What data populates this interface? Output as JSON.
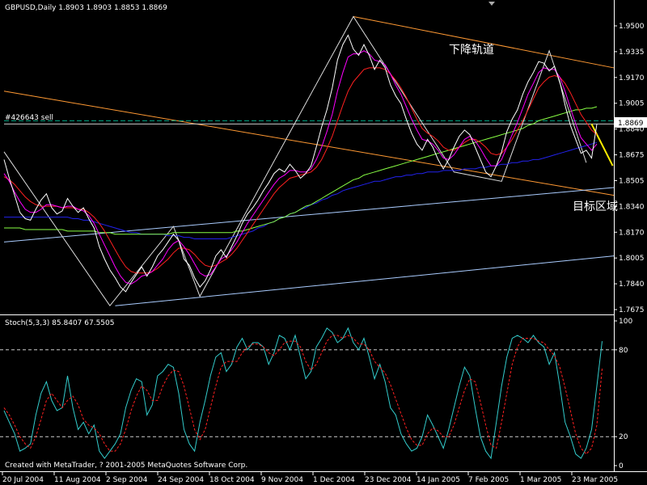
{
  "chart_data": [
    {
      "type": "line",
      "header": "GBPUSD,Daily  1.8903 1.8903 1.8853 1.8869",
      "symbol": "GBPUSD",
      "timeframe": "Daily",
      "ohlc": {
        "open": 1.8903,
        "high": 1.8903,
        "low": 1.8853,
        "close": 1.8869
      },
      "order_label": "#426643 sell",
      "price_tag": "1.8869",
      "annotations": {
        "down_channel": "下降轨道",
        "target_zone": "目标区域"
      },
      "ylim": [
        1.76,
        1.964
      ],
      "y_ticks": [
        "1.9500",
        "1.9335",
        "1.9170",
        "1.9005",
        "1.8840",
        "1.8675",
        "1.8505",
        "1.8340",
        "1.8170",
        "1.8005",
        "1.7840",
        "1.7675"
      ],
      "x_ticks": [
        "20 Jul 2004",
        "11 Aug 2004",
        "2 Sep 2004",
        "24 Sep 2004",
        "18 Oct 2004",
        "9 Nov 2004",
        "1 Dec 2004",
        "23 Dec 2004",
        "14 Jan 2005",
        "7 Feb 2005",
        "1 Mar 2005",
        "23 Mar 2005"
      ],
      "series": [
        {
          "key": "close",
          "color": "#ffffff",
          "values": [
            1.864,
            1.852,
            1.841,
            1.83,
            1.826,
            1.825,
            1.832,
            1.838,
            1.842,
            1.833,
            1.829,
            1.831,
            1.839,
            1.834,
            1.83,
            1.833,
            1.826,
            1.82,
            1.808,
            1.8,
            1.793,
            1.788,
            1.782,
            1.779,
            1.785,
            1.79,
            1.795,
            1.789,
            1.795,
            1.802,
            1.806,
            1.811,
            1.816,
            1.812,
            1.8,
            1.796,
            1.788,
            1.782,
            1.786,
            1.793,
            1.802,
            1.806,
            1.801,
            1.808,
            1.815,
            1.823,
            1.829,
            1.833,
            1.838,
            1.844,
            1.849,
            1.855,
            1.858,
            1.856,
            1.861,
            1.857,
            1.852,
            1.855,
            1.86,
            1.872,
            1.885,
            1.896,
            1.91,
            1.928,
            1.938,
            1.944,
            1.935,
            1.931,
            1.938,
            1.931,
            1.922,
            1.928,
            1.923,
            1.912,
            1.905,
            1.9,
            1.89,
            1.881,
            1.874,
            1.87,
            1.877,
            1.872,
            1.864,
            1.858,
            1.864,
            1.872,
            1.879,
            1.883,
            1.88,
            1.872,
            1.864,
            1.856,
            1.853,
            1.86,
            1.869,
            1.882,
            1.89,
            1.896,
            1.906,
            1.914,
            1.92,
            1.927,
            1.926,
            1.921,
            1.924,
            1.914,
            1.899,
            1.886,
            1.877,
            1.868,
            1.87,
            1.865,
            1.8869
          ]
        },
        {
          "key": "ma_fast",
          "color": "#ff00ff",
          "values": [
            1.855,
            1.85,
            1.843,
            1.837,
            1.832,
            1.83,
            1.83,
            1.832,
            1.835,
            1.835,
            1.834,
            1.833,
            1.834,
            1.834,
            1.832,
            1.831,
            1.828,
            1.823,
            1.816,
            1.809,
            1.802,
            1.795,
            1.789,
            1.785,
            1.784,
            1.786,
            1.789,
            1.79,
            1.792,
            1.796,
            1.8,
            1.806,
            1.81,
            1.812,
            1.808,
            1.803,
            1.797,
            1.791,
            1.789,
            1.79,
            1.795,
            1.8,
            1.802,
            1.806,
            1.811,
            1.817,
            1.823,
            1.828,
            1.833,
            1.838,
            1.843,
            1.848,
            1.852,
            1.854,
            1.857,
            1.857,
            1.856,
            1.856,
            1.858,
            1.864,
            1.872,
            1.882,
            1.893,
            1.908,
            1.92,
            1.93,
            1.932,
            1.932,
            1.934,
            1.932,
            1.928,
            1.927,
            1.925,
            1.919,
            1.912,
            1.906,
            1.898,
            1.89,
            1.883,
            1.877,
            1.876,
            1.874,
            1.87,
            1.865,
            1.864,
            1.867,
            1.872,
            1.877,
            1.879,
            1.876,
            1.871,
            1.865,
            1.86,
            1.86,
            1.864,
            1.872,
            1.88,
            1.888,
            1.897,
            1.906,
            1.913,
            1.92,
            1.923,
            1.922,
            1.922,
            1.917,
            1.908,
            1.897,
            1.887,
            1.878,
            1.874,
            1.87,
            1.874
          ]
        },
        {
          "key": "ma_mid",
          "color": "#ff2020",
          "values": [
            1.853,
            1.851,
            1.848,
            1.844,
            1.84,
            1.837,
            1.835,
            1.834,
            1.834,
            1.834,
            1.834,
            1.833,
            1.833,
            1.833,
            1.832,
            1.832,
            1.83,
            1.827,
            1.823,
            1.818,
            1.812,
            1.806,
            1.8,
            1.795,
            1.792,
            1.791,
            1.791,
            1.791,
            1.792,
            1.794,
            1.797,
            1.8,
            1.804,
            1.807,
            1.807,
            1.806,
            1.803,
            1.799,
            1.796,
            1.795,
            1.796,
            1.798,
            1.8,
            1.803,
            1.807,
            1.812,
            1.817,
            1.822,
            1.827,
            1.832,
            1.837,
            1.842,
            1.846,
            1.849,
            1.852,
            1.853,
            1.854,
            1.855,
            1.856,
            1.859,
            1.864,
            1.871,
            1.879,
            1.889,
            1.899,
            1.908,
            1.914,
            1.918,
            1.922,
            1.923,
            1.923,
            1.923,
            1.922,
            1.919,
            1.915,
            1.91,
            1.904,
            1.897,
            1.89,
            1.884,
            1.881,
            1.879,
            1.876,
            1.872,
            1.87,
            1.87,
            1.872,
            1.875,
            1.877,
            1.877,
            1.875,
            1.872,
            1.868,
            1.867,
            1.868,
            1.872,
            1.877,
            1.883,
            1.889,
            1.896,
            1.903,
            1.91,
            1.914,
            1.917,
            1.918,
            1.917,
            1.913,
            1.907,
            1.9,
            1.893,
            1.888,
            1.883,
            1.88
          ]
        },
        {
          "key": "ma_slow",
          "color": "#88ff44",
          "values": [
            1.82,
            1.82,
            1.82,
            1.82,
            1.819,
            1.819,
            1.819,
            1.819,
            1.819,
            1.819,
            1.819,
            1.819,
            1.818,
            1.818,
            1.818,
            1.818,
            1.818,
            1.818,
            1.817,
            1.817,
            1.817,
            1.816,
            1.816,
            1.816,
            1.816,
            1.816,
            1.816,
            1.816,
            1.816,
            1.816,
            1.816,
            1.816,
            1.817,
            1.817,
            1.817,
            1.817,
            1.817,
            1.817,
            1.817,
            1.817,
            1.817,
            1.817,
            1.817,
            1.817,
            1.818,
            1.818,
            1.819,
            1.82,
            1.821,
            1.822,
            1.823,
            1.824,
            1.826,
            1.827,
            1.829,
            1.83,
            1.832,
            1.834,
            1.835,
            1.837,
            1.839,
            1.841,
            1.843,
            1.845,
            1.847,
            1.849,
            1.851,
            1.852,
            1.854,
            1.855,
            1.856,
            1.857,
            1.858,
            1.859,
            1.86,
            1.861,
            1.862,
            1.863,
            1.864,
            1.865,
            1.866,
            1.867,
            1.868,
            1.869,
            1.87,
            1.871,
            1.872,
            1.873,
            1.874,
            1.875,
            1.876,
            1.877,
            1.878,
            1.879,
            1.88,
            1.881,
            1.882,
            1.883,
            1.884,
            1.886,
            1.887,
            1.889,
            1.89,
            1.891,
            1.892,
            1.893,
            1.894,
            1.895,
            1.896,
            1.896,
            1.897,
            1.897,
            1.898
          ]
        },
        {
          "key": "ma_long",
          "color": "#2222ee",
          "values": [
            1.827,
            1.827,
            1.827,
            1.827,
            1.827,
            1.827,
            1.827,
            1.827,
            1.827,
            1.827,
            1.827,
            1.827,
            1.827,
            1.826,
            1.826,
            1.825,
            1.825,
            1.824,
            1.823,
            1.822,
            1.821,
            1.82,
            1.819,
            1.818,
            1.817,
            1.817,
            1.816,
            1.816,
            1.816,
            1.816,
            1.816,
            1.815,
            1.815,
            1.815,
            1.814,
            1.814,
            1.813,
            1.813,
            1.813,
            1.813,
            1.813,
            1.813,
            1.813,
            1.814,
            1.815,
            1.816,
            1.817,
            1.818,
            1.82,
            1.821,
            1.823,
            1.824,
            1.826,
            1.827,
            1.829,
            1.83,
            1.832,
            1.833,
            1.835,
            1.836,
            1.838,
            1.839,
            1.841,
            1.842,
            1.844,
            1.845,
            1.846,
            1.847,
            1.848,
            1.849,
            1.85,
            1.85,
            1.851,
            1.852,
            1.853,
            1.853,
            1.854,
            1.854,
            1.855,
            1.855,
            1.856,
            1.856,
            1.856,
            1.857,
            1.857,
            1.857,
            1.857,
            1.858,
            1.858,
            1.858,
            1.859,
            1.859,
            1.86,
            1.86,
            1.861,
            1.861,
            1.862,
            1.862,
            1.863,
            1.863,
            1.864,
            1.864,
            1.865,
            1.866,
            1.867,
            1.868,
            1.869,
            1.87,
            1.871,
            1.872,
            1.873,
            1.874,
            1.875
          ]
        }
      ],
      "overlay_lines": [
        {
          "name": "orange-upper",
          "color": "#ff9933",
          "from": [
            0,
            1.908
          ],
          "to": [
            121,
            1.841
          ]
        },
        {
          "name": "orange-down-channel",
          "color": "#ff9933",
          "from": [
            66,
            1.956
          ],
          "to": [
            121,
            1.923
          ]
        },
        {
          "name": "lower-trend-1",
          "color": "#aaccff",
          "from": [
            0,
            1.811
          ],
          "to": [
            121,
            1.846
          ]
        },
        {
          "name": "lower-trend-2",
          "color": "#aaccff",
          "from": [
            21,
            1.77
          ],
          "to": [
            121,
            1.802
          ]
        },
        {
          "name": "hline-order",
          "color": "#00aa88",
          "dashed": true,
          "from": [
            0,
            1.889
          ],
          "to": [
            121,
            1.889
          ]
        },
        {
          "name": "hline-price",
          "color": "#cccccc",
          "from": [
            0,
            1.8869
          ],
          "to": [
            121,
            1.8869
          ]
        },
        {
          "name": "target-arrow",
          "color": "#ffee00",
          "from": [
            111,
            1.8869
          ],
          "to": [
            115,
            1.86
          ]
        }
      ]
    },
    {
      "type": "line",
      "header": "Stoch(5,3,3) 85.8407 67.5505",
      "ylim": [
        0,
        100
      ],
      "y_ticks": [
        "100",
        "80",
        "20",
        "0"
      ],
      "series": [
        {
          "key": "stoch_main",
          "color": "#33cccc",
          "values": [
            38,
            30,
            22,
            10,
            12,
            15,
            35,
            50,
            58,
            45,
            38,
            40,
            62,
            40,
            25,
            30,
            22,
            28,
            10,
            5,
            10,
            15,
            22,
            40,
            52,
            60,
            58,
            35,
            42,
            62,
            65,
            70,
            68,
            50,
            25,
            15,
            10,
            30,
            45,
            62,
            75,
            78,
            65,
            70,
            82,
            88,
            80,
            85,
            85,
            82,
            70,
            78,
            90,
            88,
            80,
            90,
            75,
            60,
            65,
            82,
            88,
            95,
            92,
            85,
            88,
            95,
            85,
            80,
            88,
            75,
            60,
            70,
            58,
            40,
            35,
            22,
            15,
            10,
            12,
            20,
            35,
            28,
            20,
            12,
            25,
            40,
            55,
            68,
            62,
            40,
            20,
            10,
            5,
            30,
            55,
            75,
            88,
            90,
            88,
            85,
            90,
            85,
            82,
            70,
            78,
            55,
            30,
            20,
            8,
            5,
            12,
            25,
            55,
            86
          ]
        },
        {
          "key": "stoch_signal",
          "color": "#ff2020",
          "dashed": true,
          "values": [
            40,
            35,
            28,
            20,
            15,
            12,
            20,
            32,
            45,
            50,
            45,
            40,
            45,
            48,
            42,
            32,
            28,
            26,
            22,
            15,
            10,
            10,
            15,
            25,
            38,
            48,
            55,
            52,
            45,
            45,
            55,
            62,
            66,
            65,
            55,
            40,
            25,
            18,
            25,
            40,
            55,
            68,
            72,
            72,
            72,
            78,
            82,
            84,
            84,
            82,
            78,
            76,
            80,
            85,
            86,
            86,
            82,
            72,
            66,
            70,
            78,
            86,
            90,
            90,
            88,
            90,
            88,
            84,
            84,
            80,
            72,
            68,
            64,
            56,
            46,
            36,
            26,
            18,
            14,
            14,
            22,
            26,
            24,
            20,
            20,
            28,
            40,
            52,
            60,
            58,
            44,
            28,
            14,
            12,
            30,
            50,
            70,
            82,
            88,
            88,
            88,
            86,
            85,
            80,
            76,
            68,
            54,
            38,
            22,
            12,
            8,
            12,
            28,
            67
          ]
        }
      ]
    }
  ],
  "footer": "Created with MetaTrader, ? 2001-2005 MetaQuotes Software Corp.",
  "colors": {
    "background": "#000000",
    "axis": "#ffffff",
    "text": "#ffffff"
  }
}
